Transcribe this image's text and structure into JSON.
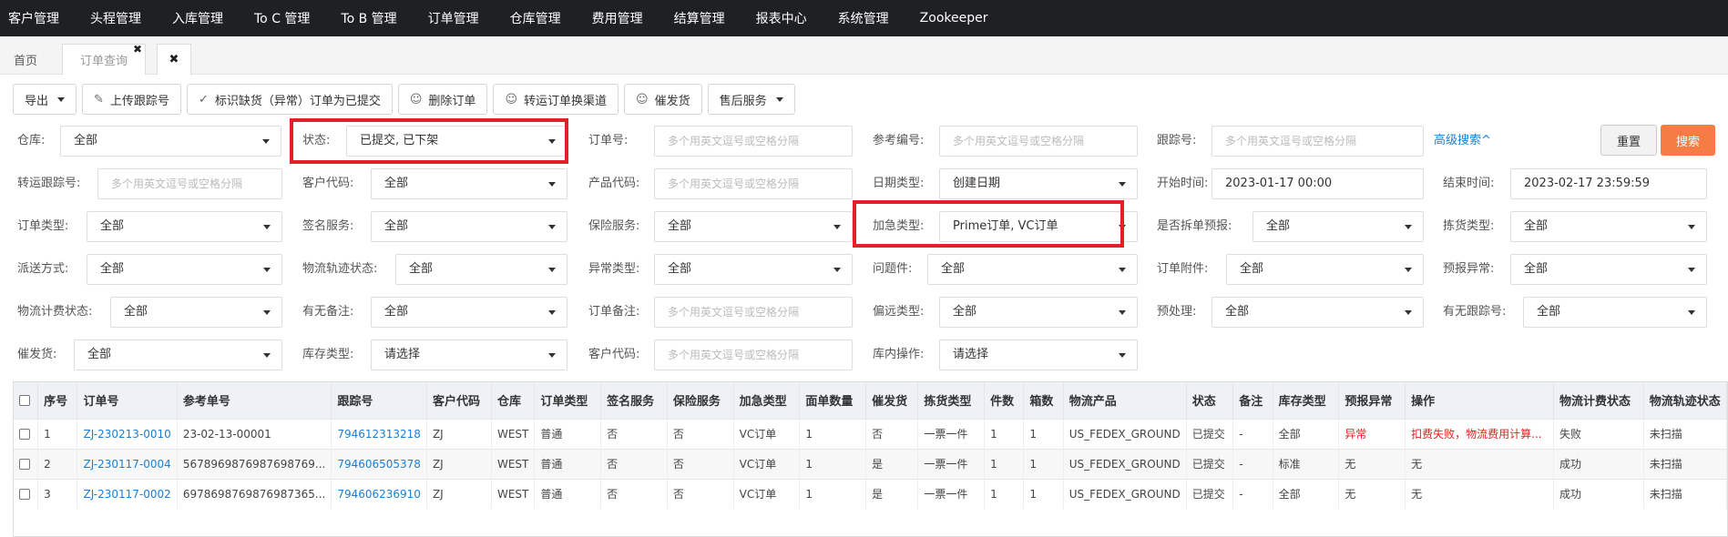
{
  "topnav": [
    "客户管理",
    "头程管理",
    "入库管理",
    "To C 管理",
    "To B 管理",
    "订单管理",
    "仓库管理",
    "费用管理",
    "结算管理",
    "报表中心",
    "系统管理",
    "Zookeeper"
  ],
  "tabs": {
    "home": "首页",
    "orders": "订单查询",
    "close_symbol": "✖",
    "close_all": "✖"
  },
  "toolbar": {
    "export": "导出",
    "upload_tracking": "上传跟踪号",
    "mark_submitted": "标识缺货（异常）订单为已提交",
    "delete_order": "删除订单",
    "transfer_channel": "转运订单换渠道",
    "urge_shipment": "催发货",
    "after_sales": "售后服务"
  },
  "filters": {
    "warehouse": {
      "label": "仓库:",
      "value": "全部"
    },
    "status": {
      "label": "状态:",
      "value": "已提交, 已下架"
    },
    "order_no": {
      "label": "订单号:",
      "placeholder": "多个用英文逗号或空格分隔"
    },
    "ref_no": {
      "label": "参考编号:",
      "placeholder": "多个用英文逗号或空格分隔"
    },
    "tracking_no": {
      "label": "跟踪号:",
      "placeholder": "多个用英文逗号或空格分隔"
    },
    "advanced": "高级搜索^",
    "reset": "重置",
    "search": "搜索",
    "transfer_tracking": {
      "label": "转运跟踪号:",
      "placeholder": "多个用英文逗号或空格分隔"
    },
    "customer_code": {
      "label": "客户代码:",
      "value": "全部"
    },
    "product_code": {
      "label": "产品代码:",
      "placeholder": "多个用英文逗号或空格分隔"
    },
    "date_type": {
      "label": "日期类型:",
      "value": "创建日期"
    },
    "start_time": {
      "label": "开始时间:",
      "value": "2023-01-17 00:00"
    },
    "end_time": {
      "label": "结束时间:",
      "value": "2023-02-17 23:59:59"
    },
    "order_type": {
      "label": "订单类型:",
      "value": "全部"
    },
    "signature": {
      "label": "签名服务:",
      "value": "全部"
    },
    "insurance": {
      "label": "保险服务:",
      "value": "全部"
    },
    "urgent_type": {
      "label": "加急类型:",
      "value": "Prime订单, VC订单"
    },
    "split_forecast": {
      "label": "是否拆单预报:",
      "value": "全部"
    },
    "picking_type": {
      "label": "拣货类型:",
      "value": "全部"
    },
    "delivery_method": {
      "label": "派送方式:",
      "value": "全部"
    },
    "logistics_track": {
      "label": "物流轨迹状态:",
      "value": "全部"
    },
    "exception_type": {
      "label": "异常类型:",
      "value": "全部"
    },
    "problem_item": {
      "label": "问题件:",
      "value": "全部"
    },
    "order_attachment": {
      "label": "订单附件:",
      "value": "全部"
    },
    "forecast_exception": {
      "label": "预报异常:",
      "value": "全部"
    },
    "logistics_billing": {
      "label": "物流计费状态:",
      "value": "全部"
    },
    "has_remark": {
      "label": "有无备注:",
      "value": "全部"
    },
    "order_remark": {
      "label": "订单备注:",
      "placeholder": "多个用英文逗号或空格分隔"
    },
    "remote_type": {
      "label": "偏远类型:",
      "value": "全部"
    },
    "preprocess": {
      "label": "预处理:",
      "value": "全部"
    },
    "has_tracking": {
      "label": "有无跟踪号:",
      "value": "全部"
    },
    "urge": {
      "label": "催发货:",
      "value": "全部"
    },
    "stock_type": {
      "label": "库存类型:",
      "value": "请选择"
    },
    "customer_code2": {
      "label": "客户代码:",
      "placeholder": "多个用英文逗号或空格分隔"
    },
    "in_warehouse_op": {
      "label": "库内操作:",
      "value": "请选择"
    }
  },
  "table": {
    "headers": [
      "序号",
      "订单号",
      "参考单号",
      "跟踪号",
      "客户代码",
      "仓库",
      "订单类型",
      "签名服务",
      "保险服务",
      "加急类型",
      "面单数量",
      "催发货",
      "拣货类型",
      "件数",
      "箱数",
      "物流产品",
      "状态",
      "备注",
      "库存类型",
      "预报异常",
      "操作",
      "物流计费状态",
      "物流轨迹状态"
    ],
    "rows": [
      [
        "1",
        "ZJ-230213-0010",
        "23-02-13-00001",
        "794612313218",
        "ZJ",
        "WEST",
        "普通",
        "否",
        "否",
        "VC订单",
        "1",
        "否",
        "一票一件",
        "1",
        "1",
        "US_FEDEX_GROUND",
        "已提交",
        "-",
        "全部",
        "异常",
        "扣费失败，物流费用计算...",
        "失败",
        "未扫描"
      ],
      [
        "2",
        "ZJ-230117-0004",
        "5678969876987698769...",
        "794606505378",
        "ZJ",
        "WEST",
        "普通",
        "否",
        "否",
        "VC订单",
        "1",
        "是",
        "一票一件",
        "1",
        "1",
        "US_FEDEX_GROUND",
        "已提交",
        "-",
        "标准",
        "无",
        "无",
        "成功",
        "未扫描"
      ],
      [
        "3",
        "ZJ-230117-0002",
        "6978698769876987365...",
        "794606236910",
        "ZJ",
        "WEST",
        "普通",
        "否",
        "否",
        "VC订单",
        "1",
        "是",
        "一票一件",
        "1",
        "1",
        "US_FEDEX_GROUND",
        "已提交",
        "-",
        "全部",
        "无",
        "无",
        "成功",
        "未扫描"
      ]
    ]
  }
}
